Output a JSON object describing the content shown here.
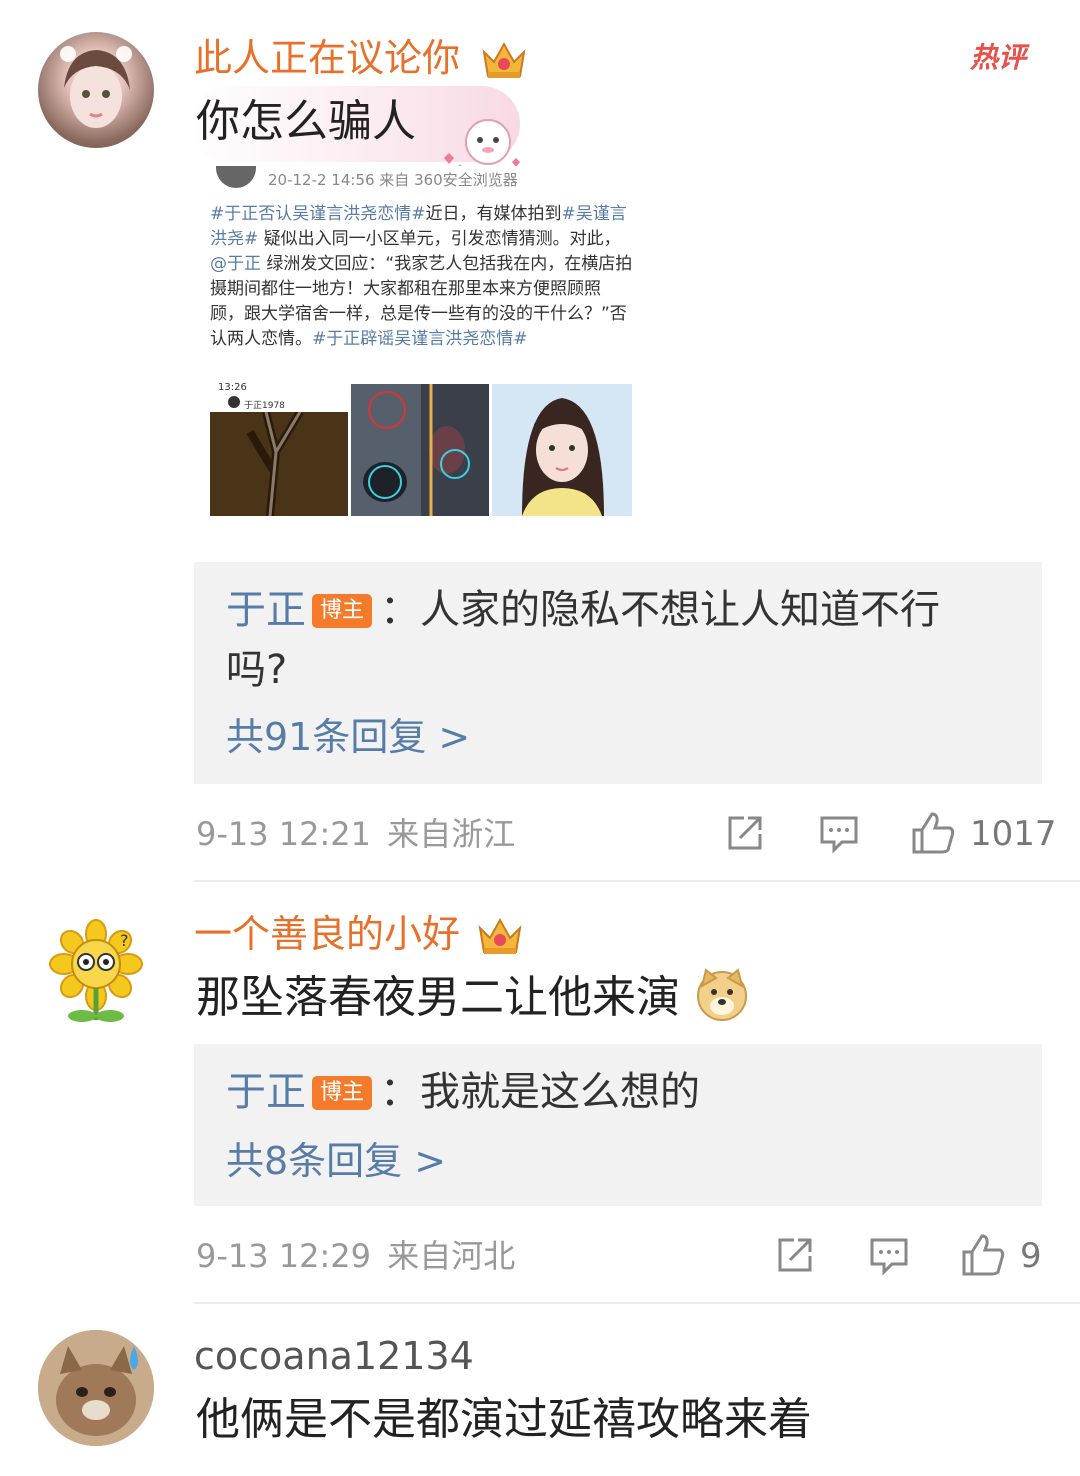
{
  "comments": [
    {
      "username": "此人正在议论你",
      "text": "你怎么骗人",
      "hot_label": "热评",
      "post_image": {
        "partial_header": "20-12-2 14:56 来自 360安全浏览器",
        "tag1": "#于正否认吴谨言洪尧恋情#",
        "text1": "近日，有媒体拍到",
        "tag2": "#吴谨言洪尧#",
        "text2": " 疑似出入同一小区单元，引发恋情猜测。对此，",
        "mention": "@于正",
        "text3": " 绿洲发文回应：“我家艺人包括我在内，在横店拍摄期间都住一地方！大家都租在那里本来方便照顾照顾，跟大学宿舍一样，总是传一些有的没的干什么？”否认两人恋情。",
        "tag3": "#于正辟谣吴谨言洪尧恋情#",
        "phone_time": "13:26",
        "phone_user": "于正1978"
      },
      "reply": {
        "author": "于正",
        "badge": "博主",
        "text": "：人家的隐私不想让人知道不行吗?",
        "more": "共91条回复 >"
      },
      "time": "9-13 12:21",
      "location": "来自浙江",
      "likes": "1017"
    },
    {
      "username": "一个善良的小好",
      "text": "那坠落春夜男二让他来演",
      "reply": {
        "author": "于正",
        "badge": "博主",
        "text": "：我就是这么想的",
        "more": "共8条回复 >"
      },
      "time": "9-13 12:29",
      "location": "来自河北",
      "likes": "9"
    },
    {
      "username": "cocoana12134",
      "text": "他俩是不是都演过延禧攻略来着"
    }
  ],
  "icons": {
    "repost": "share-icon",
    "comment": "comment-icon",
    "like": "thumbs-up-icon",
    "crown": "crown-icon"
  },
  "colors": {
    "username_vip": "#e8702a",
    "link_blue": "#587ca8",
    "badge_orange": "#f57b2c",
    "meta_gray": "#999999",
    "reply_bg": "#f2f2f2"
  }
}
